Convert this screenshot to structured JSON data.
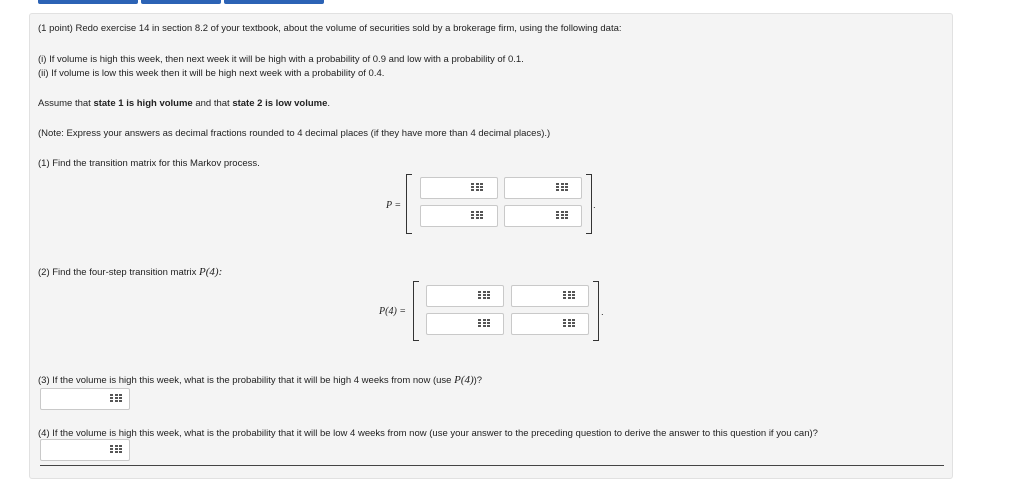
{
  "intro": "(1 point) Redo exercise 14 in section 8.2 of your textbook, about the volume of securities sold by a brokerage firm, using the following data:",
  "cond1": "(i) If volume is high this week, then next week it will be high with a probability of 0.9 and low with a probability of 0.1.",
  "cond2": "(ii) If volume is low this week then it will be high next week with a probability of 0.4.",
  "assume": {
    "pre": "Assume that ",
    "state1": "state 1 is high volume",
    "mid": " and that ",
    "state2": "state 2 is low volume",
    "post": "."
  },
  "note": "(Note: Express your answers as decimal fractions rounded to 4 decimal places (if they have more than 4 decimal places).)",
  "q1": "(1) Find the transition matrix for this Markov process.",
  "q1_label": "P =",
  "q2_text": "(2) Find the four-step transition matrix ",
  "q2_math": "P(4):",
  "q2_label": "P(4) =",
  "q3_text": "(3) If the volume is high this week, what is the probability that it will be high 4 weeks from now (use ",
  "q3_math": "P(4)",
  "q3_end": ")?",
  "q4": "(4) If the volume is high this week, what is the probability that it will be low 4 weeks from now (use your answer to the preceding question to derive the answer to this question if you can)?",
  "period": ".",
  "inputs": {
    "p11": "",
    "p12": "",
    "p21": "",
    "p22": "",
    "p4_11": "",
    "p4_12": "",
    "p4_21": "",
    "p4_22": "",
    "q3_answer": "",
    "q4_answer": ""
  },
  "icons": {
    "matrix_button": "matrix-entry-icon"
  },
  "colors": {
    "panel_bg": "#f4f4f4",
    "tab_blue": "#2c63b5"
  }
}
